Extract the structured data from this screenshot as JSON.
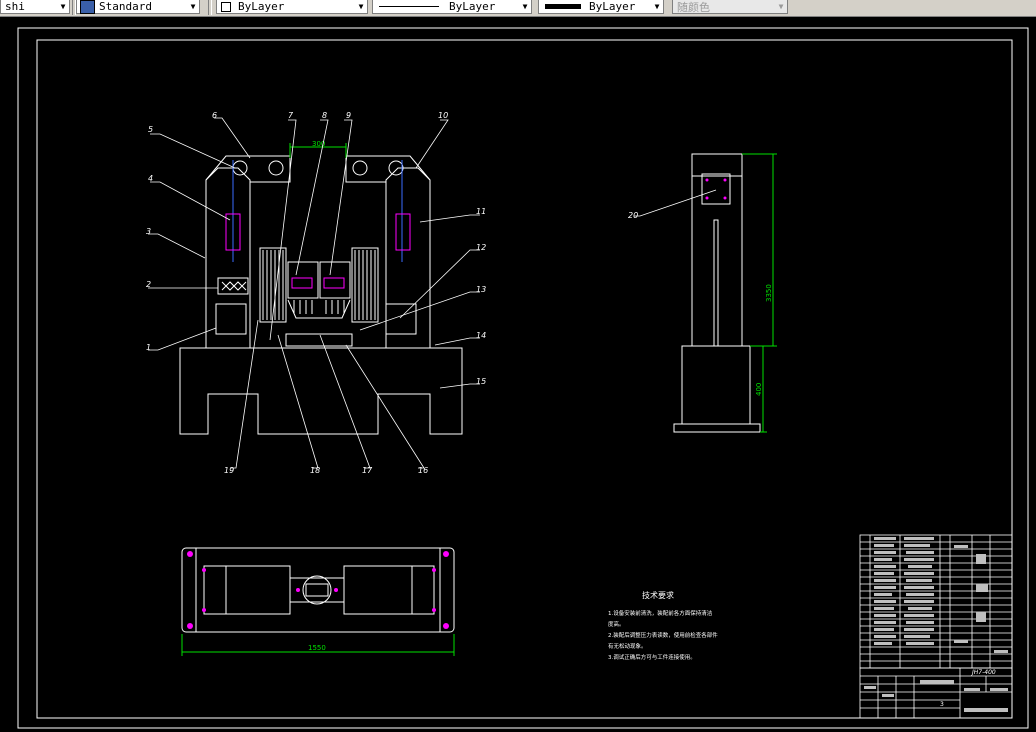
{
  "toolbar": {
    "layer": "shi",
    "text_style": "Standard",
    "color": "ByLayer",
    "linetype": "ByLayer",
    "lineweight": "ByLayer",
    "plot_style": "随颜色"
  },
  "drawing": {
    "front_view": {
      "dimension": "300",
      "part_labels": [
        "1",
        "2",
        "3",
        "4",
        "5",
        "6",
        "7",
        "8",
        "9",
        "10",
        "11",
        "12",
        "13",
        "14",
        "15",
        "16",
        "17",
        "18",
        "19"
      ]
    },
    "side_view": {
      "part_label": "20",
      "dim_height": "3350",
      "dim_base": "400"
    },
    "top_view": {
      "dim_length": "1550"
    },
    "notes": {
      "title": "技术要求",
      "lines": [
        "1.设备安装前清洗，装配前各方面保持清洁",
        "度高。",
        "2.装配后调整压力表读数，使用前检查各部件",
        "有无松动现象。",
        "3.调试正确后方可与工件连接使用。"
      ]
    },
    "title_block": {
      "drawing_number": "JH7-400",
      "sheet": "3"
    }
  }
}
